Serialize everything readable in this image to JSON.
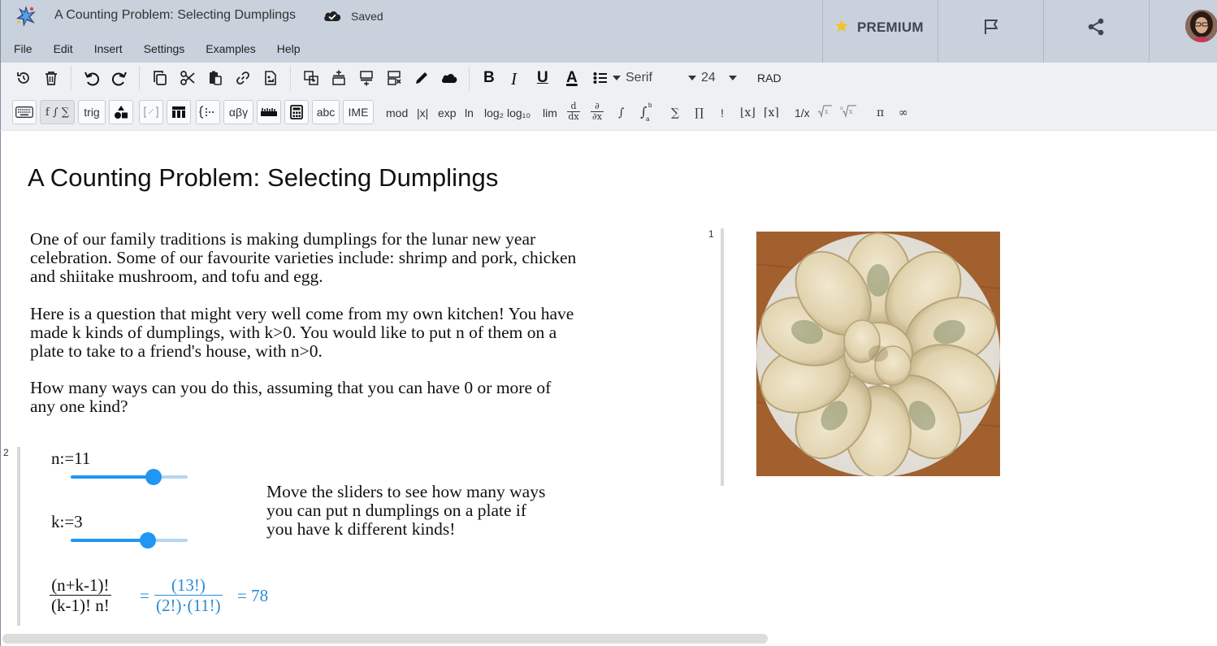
{
  "header": {
    "doc_title": "A Counting Problem: Selecting Dumplings",
    "save_status": "Saved",
    "premium_label": "PREMIUM"
  },
  "menu": [
    "File",
    "Edit",
    "Insert",
    "Settings",
    "Examples",
    "Help"
  ],
  "toolbar": {
    "font_family": "Serif",
    "font_size": "24",
    "angle_mode": "RAD",
    "bold": "B",
    "italic": "I",
    "underline": "U",
    "text_color": "A"
  },
  "palette": {
    "functions": "f ∫ ∑",
    "trig": "trig",
    "greek": "αβγ",
    "abc": "abc",
    "ime": "IME",
    "mod": "mod",
    "abs": "|x|",
    "exp": "exp",
    "ln": "ln",
    "log2": "log₂",
    "log10": "log₁₀",
    "lim": "lim",
    "sum": "∑",
    "prod": "∏",
    "factorial": "!",
    "floor": "⌊x⌋",
    "ceil": "⌈x⌉",
    "reciprocal": "1/x",
    "pi": "π",
    "infinity": "∞"
  },
  "document": {
    "title": "A Counting Problem: Selecting Dumplings",
    "region1_number": "1",
    "region2_number": "2",
    "para1_lines": [
      "One of our family traditions is making dumplings for the lunar new year",
      "celebration. Some of our favourite varieties include: shrimp and pork, chicken",
      "and shiitake mushroom, and tofu and egg."
    ],
    "para2_lines": [
      "Here is a question that might very well come from my own kitchen! You have",
      "made k kinds of dumplings, with k>0. You would like to put n of them on a",
      "plate to take to a friend's house, with n>0."
    ],
    "para3_lines": [
      "How many ways can you do this, assuming that you can have 0 or more of",
      "any one kind?"
    ],
    "n_def": "n:=11",
    "k_def": "k:=3",
    "n_slider_level": 0.71,
    "k_slider_level": 0.66,
    "note_lines": [
      "Move the sliders to see how many ways",
      "you can put n dumplings on a plate if",
      "you have k different kinds!"
    ],
    "formula_num": "(n+k-1)!",
    "formula_den": "(k-1)! n!",
    "eq1": "=",
    "result_num": "(13!)",
    "result_den": "(2!)·(11!)",
    "result_value": "= 78"
  },
  "colors": {
    "accent": "#2196f3",
    "result": "#2a8bd6",
    "header_bg": "#c9d1dd",
    "toolbar_bg": "#eef0f3"
  }
}
